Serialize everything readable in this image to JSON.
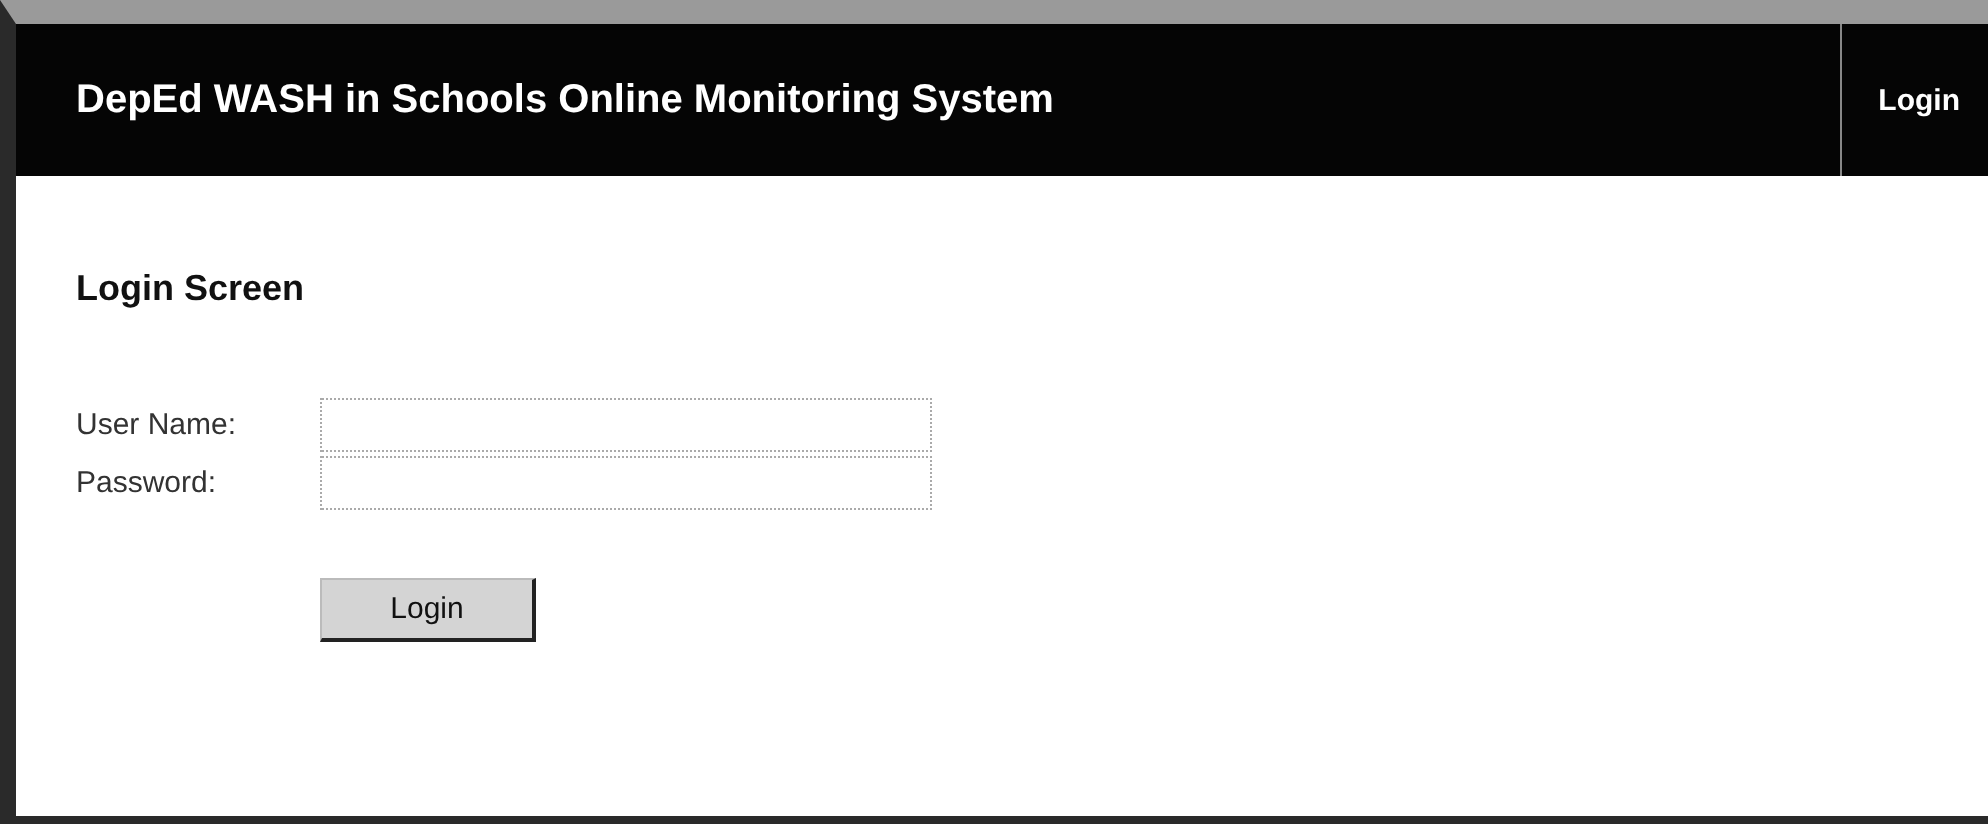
{
  "header": {
    "title": "DepEd WASH in Schools Online Monitoring System",
    "nav": [
      {
        "label": "Login"
      }
    ]
  },
  "form": {
    "heading": "Login Screen",
    "fields": [
      {
        "label": "User Name:"
      },
      {
        "label": "Password:"
      }
    ],
    "submit": "Login"
  }
}
